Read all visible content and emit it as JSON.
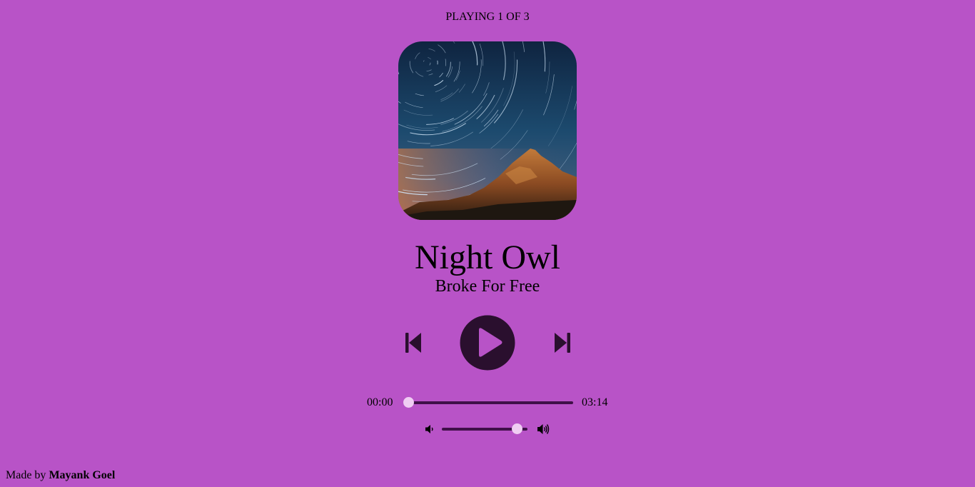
{
  "player": {
    "now_playing": "PLAYING 1 OF 3",
    "track_name": "Night Owl",
    "track_artist": "Broke For Free",
    "current_time": "00:00",
    "total_duration": "03:14",
    "seek_progress": 0,
    "volume_level": 0.93
  },
  "controls": {
    "prev_icon": "skip-previous-icon",
    "play_icon": "play-icon",
    "next_icon": "skip-next-icon",
    "volume_down_icon": "volume-down-icon",
    "volume_up_icon": "volume-up-icon"
  },
  "footer": {
    "prefix": "Made by",
    "author": "Mayank Goel"
  },
  "colors": {
    "background": "#b853c7",
    "control_dark": "#2a0f2e",
    "slider_track": "#3f1048",
    "slider_thumb": "#f0cdf3"
  }
}
